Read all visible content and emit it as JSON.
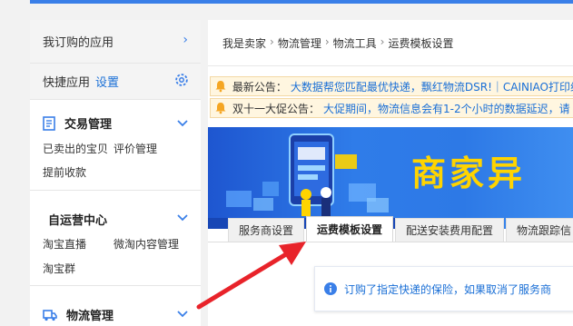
{
  "sidebar": {
    "subscribed_apps": "我订购的应用",
    "quick_apps": "快捷应用",
    "quick_setting": "设置",
    "groups": [
      {
        "title": "交易管理",
        "links": [
          "已卖出的宝贝",
          "评价管理",
          "提前收款"
        ]
      },
      {
        "title": "自运营中心",
        "links": [
          "淘宝直播",
          "微淘内容管理",
          "淘宝群"
        ]
      },
      {
        "title": "物流管理",
        "links": []
      }
    ]
  },
  "breadcrumb": [
    "我是卖家",
    "物流管理",
    "物流工具",
    "运费模板设置"
  ],
  "breadcrumb_separator": "›",
  "notices": [
    {
      "label": "最新公告：",
      "text": "大数据帮您匹配最优快递，飘红物流DSR!｜CAINIAO打印组"
    },
    {
      "label": "双十一大促公告：",
      "text": "大促期间，物流信息会有1-2个小时的数据延迟，请"
    }
  ],
  "banner": {
    "title": "商家异"
  },
  "tabs": [
    "服务商设置",
    "运费模板设置",
    "配送安装费用配置",
    "物流跟踪信"
  ],
  "info_message": "订购了指定快递的保险，如果取消了服务商",
  "colors": {
    "accent": "#3a7fe8",
    "link": "#1a6fd6",
    "arrow": "#e8232a",
    "banner_text": "#ffd400"
  }
}
